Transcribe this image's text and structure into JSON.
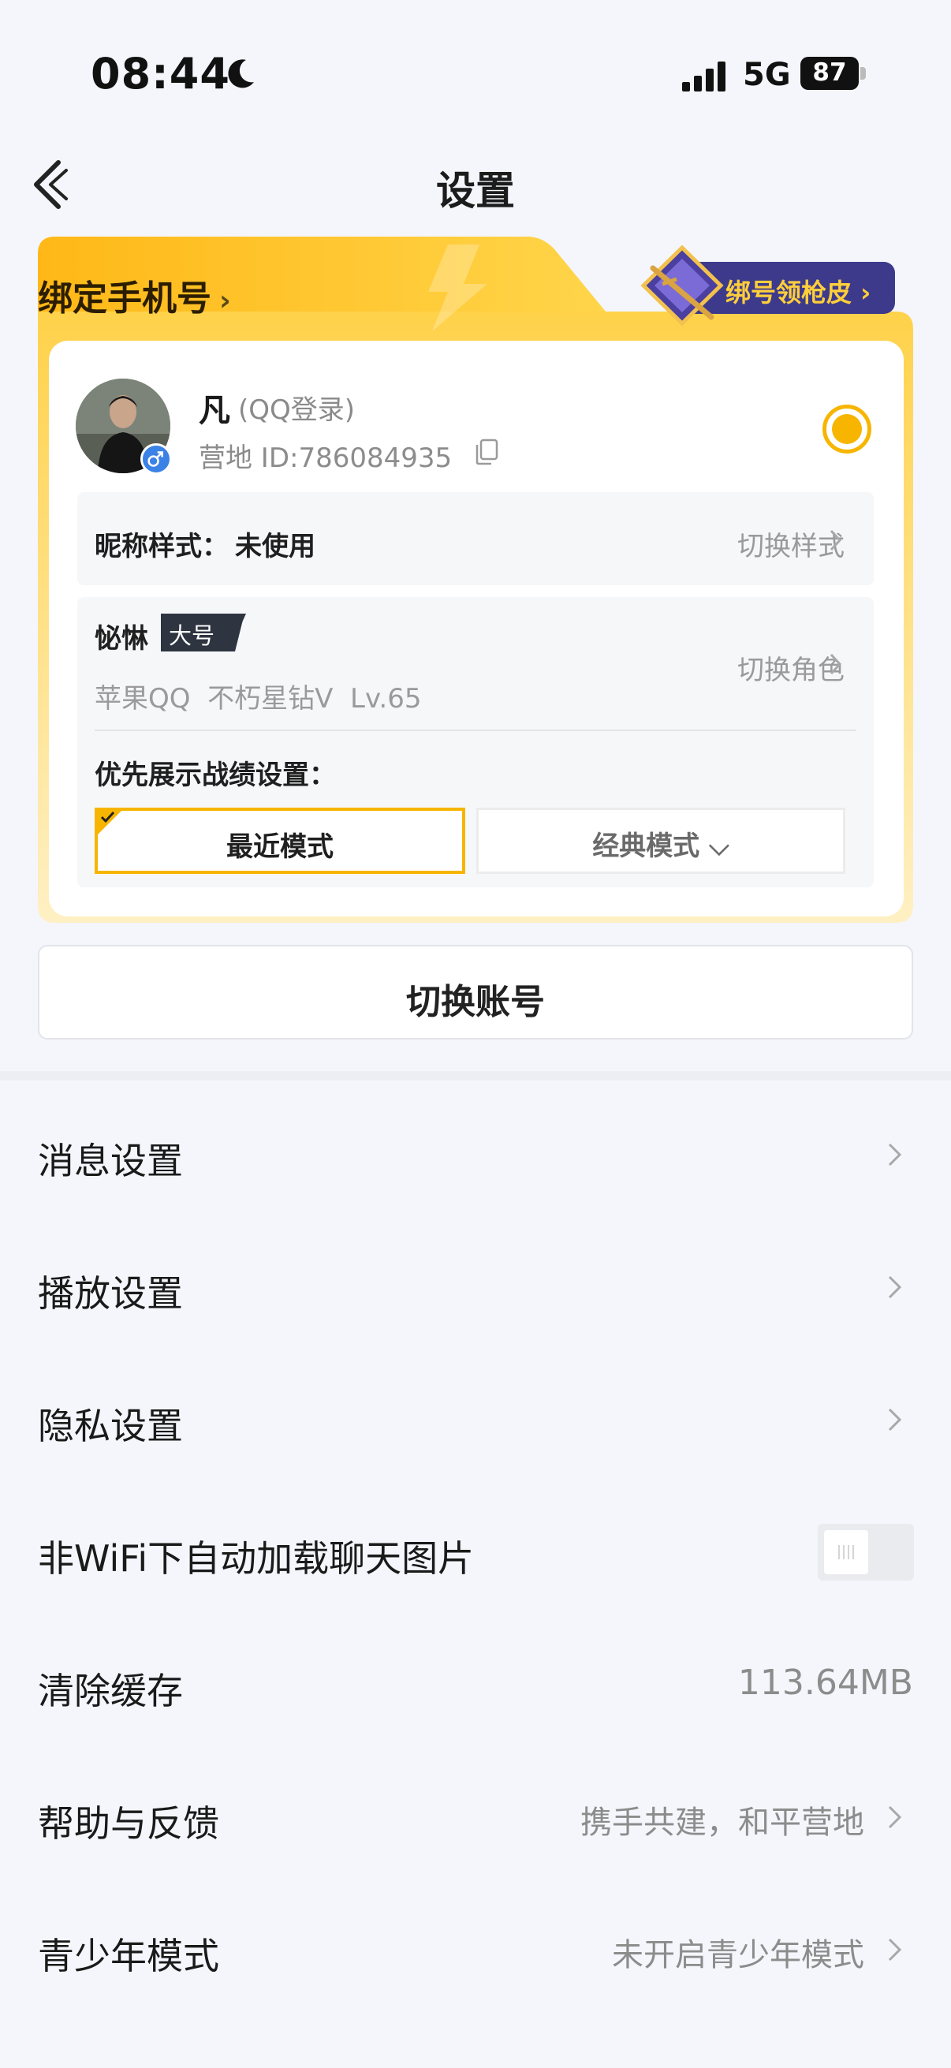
{
  "status_bar": {
    "time": "08:44",
    "network": "5G",
    "battery": "87"
  },
  "nav": {
    "title": "设置"
  },
  "account_card": {
    "bind_phone_label": "绑定手机号",
    "bind_phone_chevron": "›",
    "skin_promo": "绑号领枪皮 ›",
    "user_name": "凡",
    "login_type": "(QQ登录)",
    "user_id": "营地 ID:786084935",
    "nickname_style_label": "昵称样式：",
    "nickname_style_value": "未使用",
    "switch_style": "切换样式",
    "role_name": "怭惏",
    "role_tag": "大号",
    "role_meta": "苹果QQ  不朽星钻V  Lv.65",
    "switch_role": "切换角色",
    "record_setting_label": "优先展示战绩设置：",
    "mode_recent": "最近模式",
    "mode_classic": "经典模式 ⌵"
  },
  "switch_account": "切换账号",
  "settings": [
    {
      "label": "消息设置"
    },
    {
      "label": "播放设置"
    },
    {
      "label": "隐私设置"
    },
    {
      "label": "非WiFi下自动加载聊天图片",
      "toggle": false
    },
    {
      "label": "清除缓存",
      "value": "113.64MB"
    },
    {
      "label": "帮助与反馈",
      "value": "携手共建，和平营地"
    },
    {
      "label": "青少年模式",
      "value": "未开启青少年模式"
    }
  ],
  "colors": {
    "accent": "#f7b500",
    "background": "#f4f6fb",
    "promo_bg": "#3d3a8c",
    "promo_text": "#ffcf3a"
  }
}
